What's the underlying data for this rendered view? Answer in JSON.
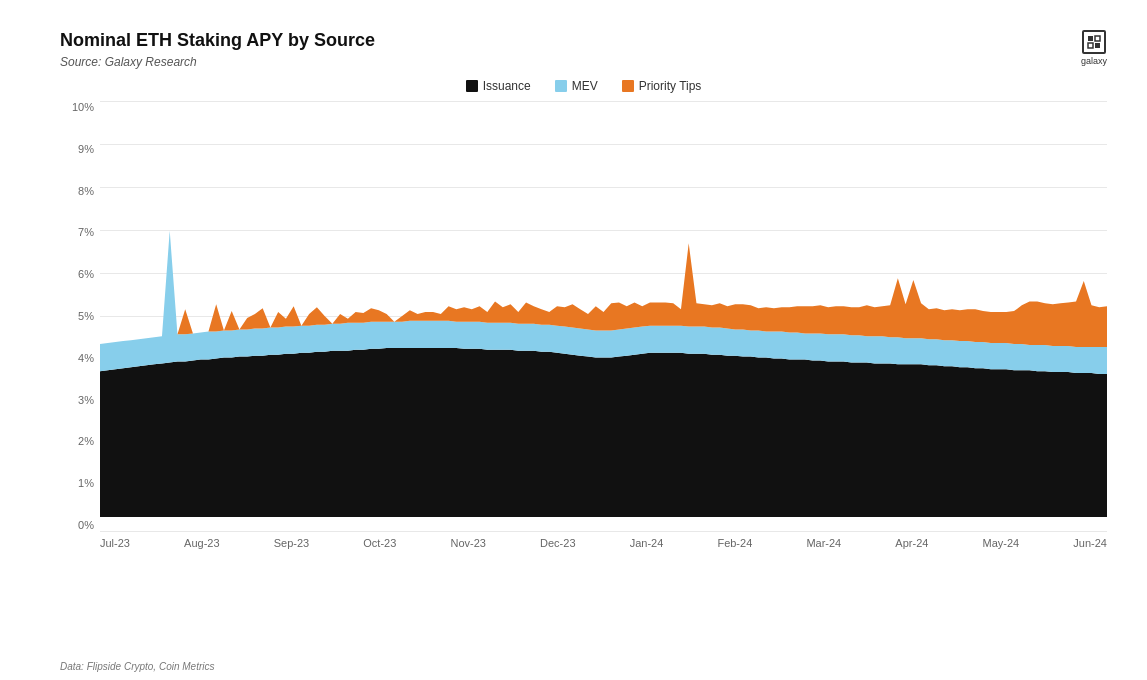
{
  "title": "Nominal ETH Staking APY by Source",
  "subtitle": "Source: Galaxy Research",
  "dataSource": "Data: Flipside Crypto, Coin Metrics",
  "legend": [
    {
      "label": "Issuance",
      "color": "#111111"
    },
    {
      "label": "MEV",
      "color": "#87CEEB"
    },
    {
      "label": "Priority Tips",
      "color": "#E87722"
    }
  ],
  "yAxis": {
    "labels": [
      "10%",
      "9%",
      "8%",
      "7%",
      "6%",
      "5%",
      "4%",
      "3%",
      "2%",
      "1%",
      "0%"
    ]
  },
  "xAxis": {
    "labels": [
      "Jul-23",
      "Aug-23",
      "Sep-23",
      "Oct-23",
      "Nov-23",
      "Dec-23",
      "Jan-24",
      "Feb-24",
      "Mar-24",
      "Apr-24",
      "May-24",
      "Jun-24"
    ]
  },
  "galaxy": {
    "label": "galaxy"
  }
}
